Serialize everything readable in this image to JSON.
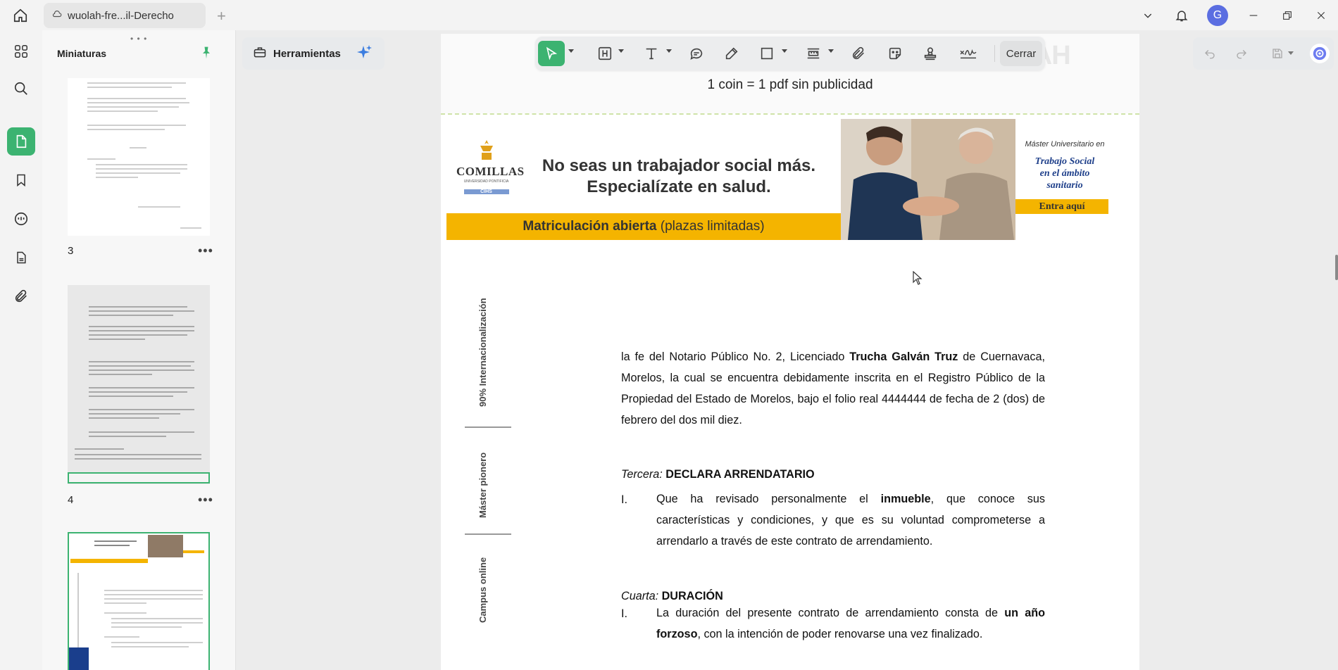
{
  "titlebar": {
    "tab_title": "wuolah-fre...il-Derecho",
    "new_tab": "+",
    "avatar_letter": "G"
  },
  "rail": {
    "items": [
      "apps-icon",
      "search-icon",
      "page-icon",
      "bookmark-icon",
      "comment-icon",
      "doc-icon",
      "attachment-icon"
    ],
    "active": "page-icon"
  },
  "thumbnails": {
    "title": "Miniaturas",
    "grip": "• • •",
    "pages": [
      {
        "number": "3",
        "more": "•••"
      },
      {
        "number": "4",
        "more": "•••"
      },
      {
        "number": "",
        "more": ""
      }
    ]
  },
  "tools": {
    "label": "Herramientas"
  },
  "floating_toolbar": {
    "close_label": "Cerrar",
    "active_tool": "select"
  },
  "page": {
    "coin_text": "1 coin = 1 pdf sin publicidad",
    "watermark": "OLAH",
    "banner": {
      "logo_name": "COMILLAS",
      "logo_sub": "UNIVERSIDAD PONTIFICIA",
      "logo_badge": "CIHS",
      "slogan_line1": "No seas un trabajador social más.",
      "slogan_line2": "Especialízate en salud.",
      "bar_bold": "Matriculación abierta",
      "bar_rest": " (plazas limitadas)",
      "master_small": "Máster Universitario en",
      "master_line1": "Trabajo Social",
      "master_line2": "en el ámbito sanitario",
      "cta": "Entra aquí"
    },
    "side_labels": [
      "90% Internacionalización",
      "Máster pionero",
      "Campus online"
    ],
    "paragraph1": {
      "pre": "la fe del Notario Público No. 2, Licenciado ",
      "bold": "Trucha Galván Truz",
      "post": " de Cuernavaca, Morelos, la cual se encuentra debidamente inscrita en el Registro Público de la Propiedad del Estado de Morelos, bajo el folio real 4444444 de fecha de 2 (dos) de febrero del dos mil diez."
    },
    "section3": {
      "italic": "Tercera:",
      "bold": " DECLARA ARRENDATARIO",
      "item_num": "I.",
      "item_pre": "Que ha revisado personalmente el ",
      "item_bold": "inmueble",
      "item_post": ", que conoce sus características y condiciones, y que es su voluntad comprometerse a arrendarlo a través de este contrato de arrendamiento."
    },
    "section4": {
      "italic": "Cuarta:",
      "bold": " DURACIÓN",
      "item_num": "I.",
      "item_pre": "La duración del presente contrato de arrendamiento consta de ",
      "item_bold": "un año forzoso",
      "item_post": ", con la intención de poder renovarse una vez finalizado."
    }
  },
  "colors": {
    "accent": "#3cb371",
    "banner_yellow": "#f4b400",
    "master_blue": "#1e3f8a"
  }
}
